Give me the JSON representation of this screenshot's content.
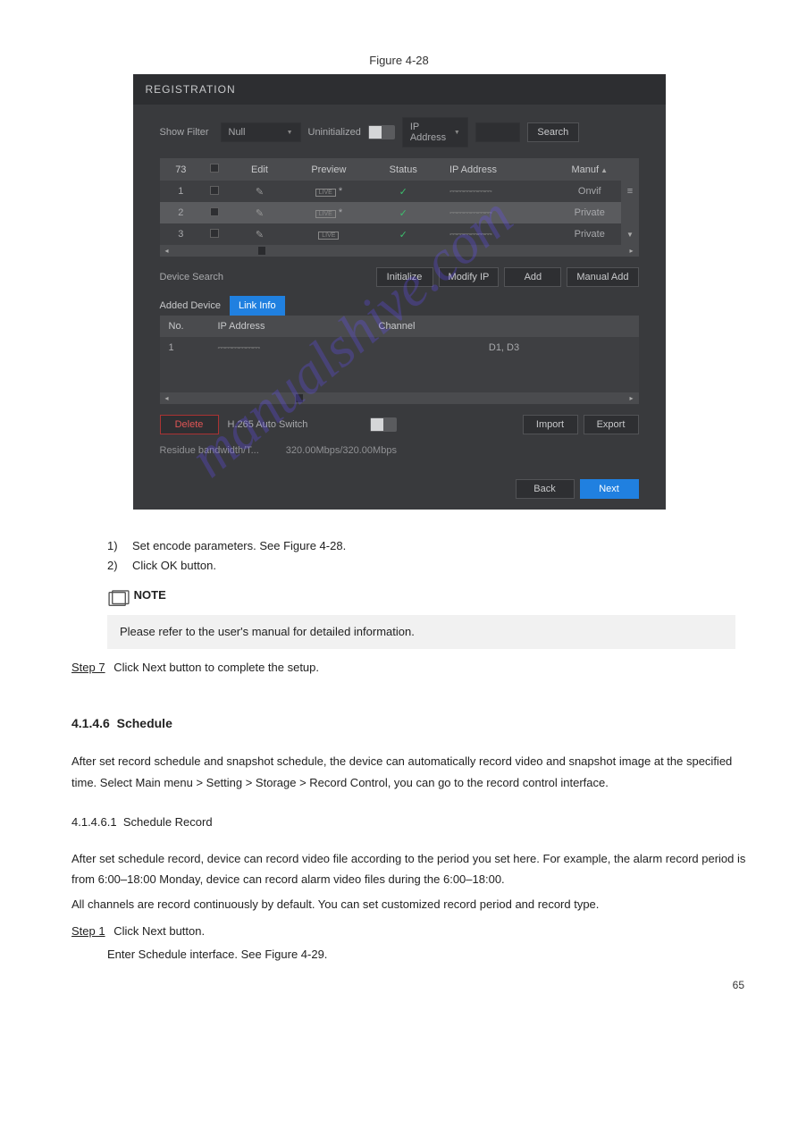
{
  "figure_caption": "Figure 4-28",
  "dialog": {
    "title": "REGISTRATION",
    "filter": {
      "show_filter_label": "Show Filter",
      "null_option": "Null",
      "uninitialized_label": "Uninitialized",
      "ip_address_option": "IP Address",
      "search_button": "Search"
    },
    "devices_table": {
      "header_count": "73",
      "col_edit": "Edit",
      "col_preview": "Preview",
      "col_status": "Status",
      "col_ip": "IP Address",
      "col_manuf": "Manuf"
    },
    "devices_rows": [
      {
        "n": "1",
        "preview": "LIVE",
        "star": "*",
        "ip": "⎓⎓⎓⎓⎓⎓",
        "manuf": "Onvif"
      },
      {
        "n": "2",
        "preview": "LIVE",
        "star": "*",
        "ip": "⎓⎓⎓⎓⎓⎓",
        "manuf": "Private"
      },
      {
        "n": "3",
        "preview": "LIVE",
        "star": "",
        "ip": "⎓⎓⎓⎓⎓⎓",
        "manuf": "Private"
      }
    ],
    "actions": {
      "device_search": "Device Search",
      "initialize": "Initialize",
      "modify_ip": "Modify IP",
      "add": "Add",
      "manual_add": "Manual Add"
    },
    "tabs": {
      "added_device": "Added Device",
      "link_info": "Link Info"
    },
    "link_table": {
      "col_no": "No.",
      "col_ip": "IP Address",
      "col_channel": "Channel"
    },
    "link_rows": [
      {
        "no": "1",
        "ip": "⎓⎓⎓⎓⎓⎓",
        "channel": "D1, D3"
      }
    ],
    "bottom": {
      "delete": "Delete",
      "h265": "H.265 Auto Switch",
      "import": "Import",
      "export": "Export",
      "bandwidth_label": "Residue bandwidth/T...",
      "bandwidth_value": "320.00Mbps/320.00Mbps"
    },
    "footer": {
      "back": "Back",
      "next": "Next"
    }
  },
  "doc": {
    "step7_num": "Step 7",
    "step7_text": "Click Next button to complete the setup.",
    "note_text": "NOTE",
    "note_body": "Please refer to the user's manual for detailed information.",
    "section_num": "4.1.4.6",
    "section_title": "Schedule",
    "section_body": "After set record schedule and snapshot schedule, the device can automatically record video and snapshot image at the specified time. Select Main menu > Setting > Storage > Record Control, you can go to the record control interface.",
    "subsection_num": "4.1.4.6.1",
    "subsection_title": "Schedule Record",
    "subsection_body": "After set schedule record, device can record video file according to the period you set here. For example, the alarm record period is from 6:00–18:00 Monday, device can record alarm video files during the 6:00–18:00.",
    "subsection_body2": "All channels are record continuously by default. You can set customized record period and record type.",
    "sub_step1_num": "Step 1",
    "sub_step1_text": "Click Next button.",
    "sub_step1_body": "Enter Schedule interface. See Figure 4-29.",
    "sub_steps": [
      {
        "num": "1)",
        "text": "Set encode parameters. See Figure 4-28."
      },
      {
        "num": "2)",
        "text": "Click OK button."
      }
    ]
  },
  "page_number": "65",
  "watermark": "manualshive.com"
}
